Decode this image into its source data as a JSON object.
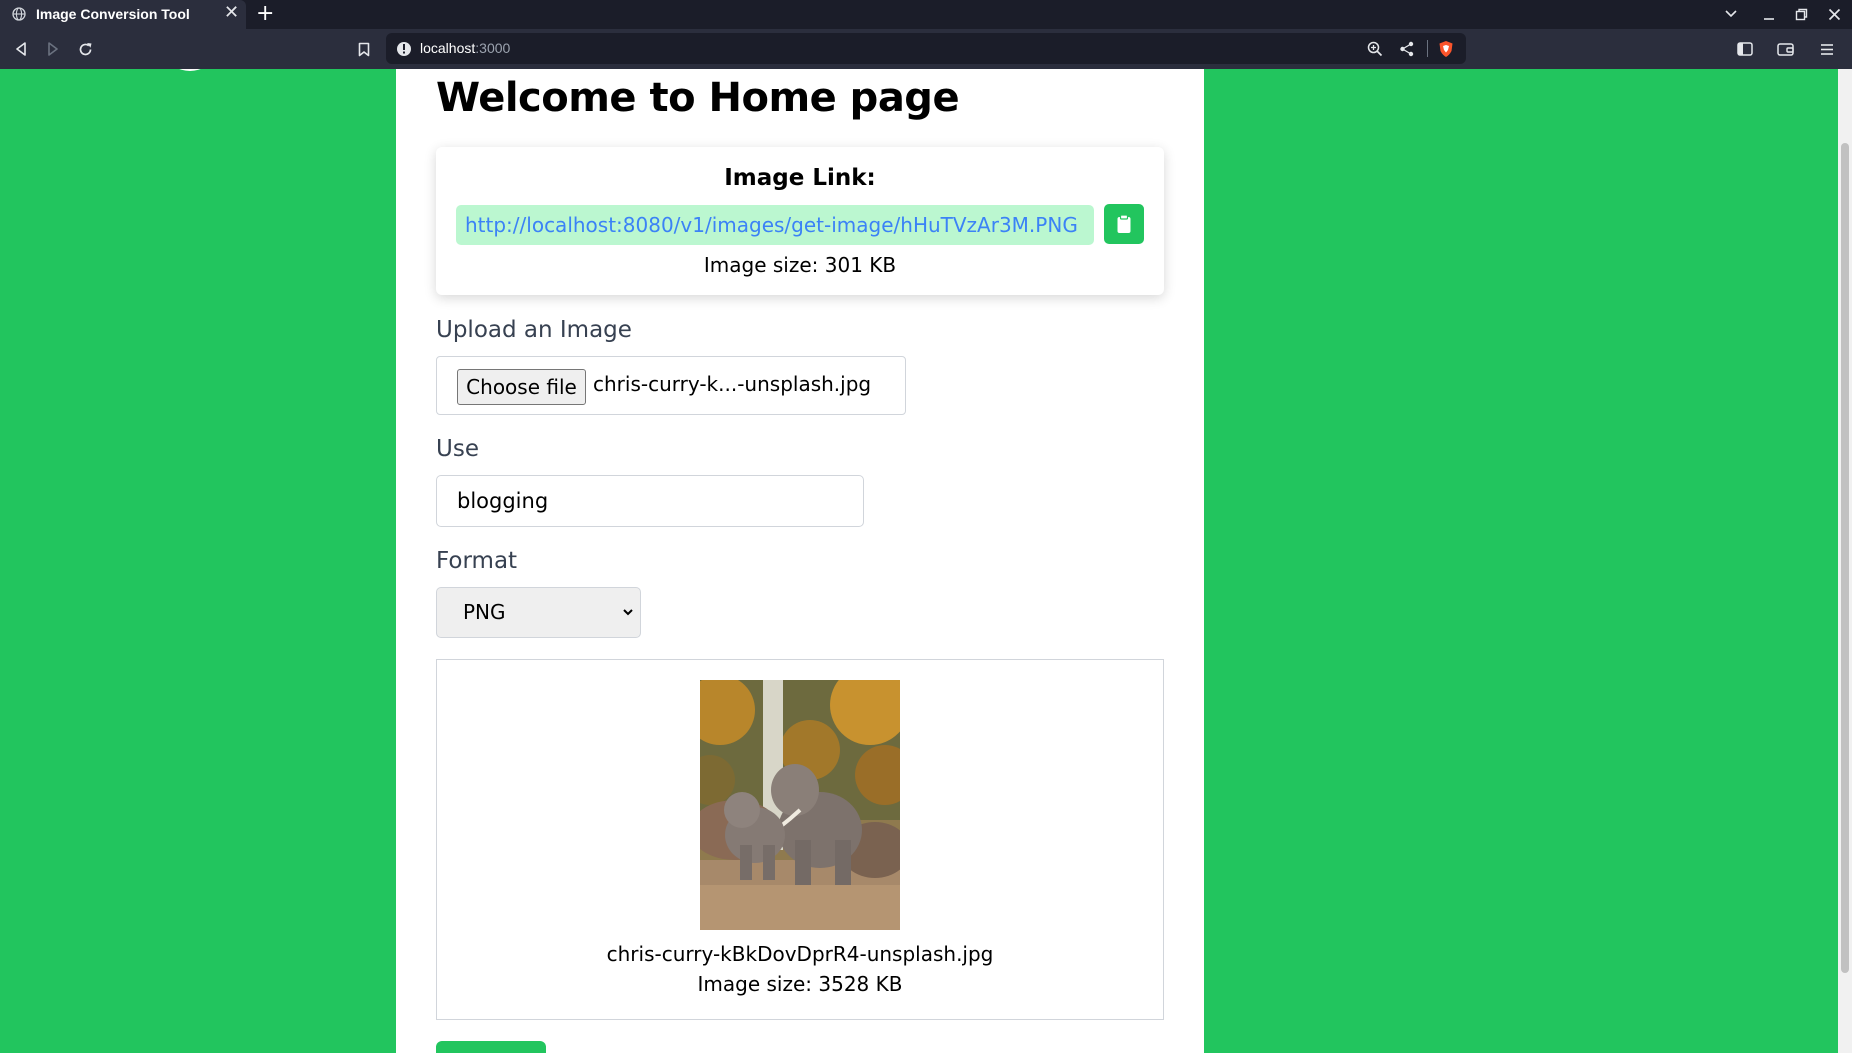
{
  "browser": {
    "tab_title": "Image Conversion Tool",
    "new_tab": "+",
    "close": "✕",
    "url_host": "localhost",
    "url_port": ":3000"
  },
  "page": {
    "title": "Welcome to Home page",
    "link_section": {
      "heading": "Image Link:",
      "url": "http://localhost:8080/v1/images/get-image/hHuTVzAr3M.PNG",
      "size": "Image size: 301 KB"
    },
    "upload": {
      "label": "Upload an Image",
      "button": "Choose file",
      "file_name": "chris-curry-k...-unsplash.jpg"
    },
    "use": {
      "label": "Use",
      "value": "blogging"
    },
    "format": {
      "label": "Format",
      "selected": "PNG"
    },
    "preview": {
      "file_name": "chris-curry-kBkDovDprR4-unsplash.jpg",
      "size": "Image size: 3528 KB"
    }
  },
  "colors": {
    "page_background": "#22c55e",
    "link_background": "#bbf7d0",
    "link_text": "#3b82f6",
    "browser_dark": "#1b1d29",
    "browser_toolbar": "#2b2e3d"
  },
  "icons": [
    "globe-icon",
    "back-icon",
    "forward-icon",
    "reload-icon",
    "bookmark-icon",
    "info-icon",
    "zoom-icon",
    "share-icon",
    "brave-shield-icon",
    "sidebar-icon",
    "wallet-icon",
    "menu-icon",
    "clipboard-icon",
    "chevron-down-icon"
  ]
}
